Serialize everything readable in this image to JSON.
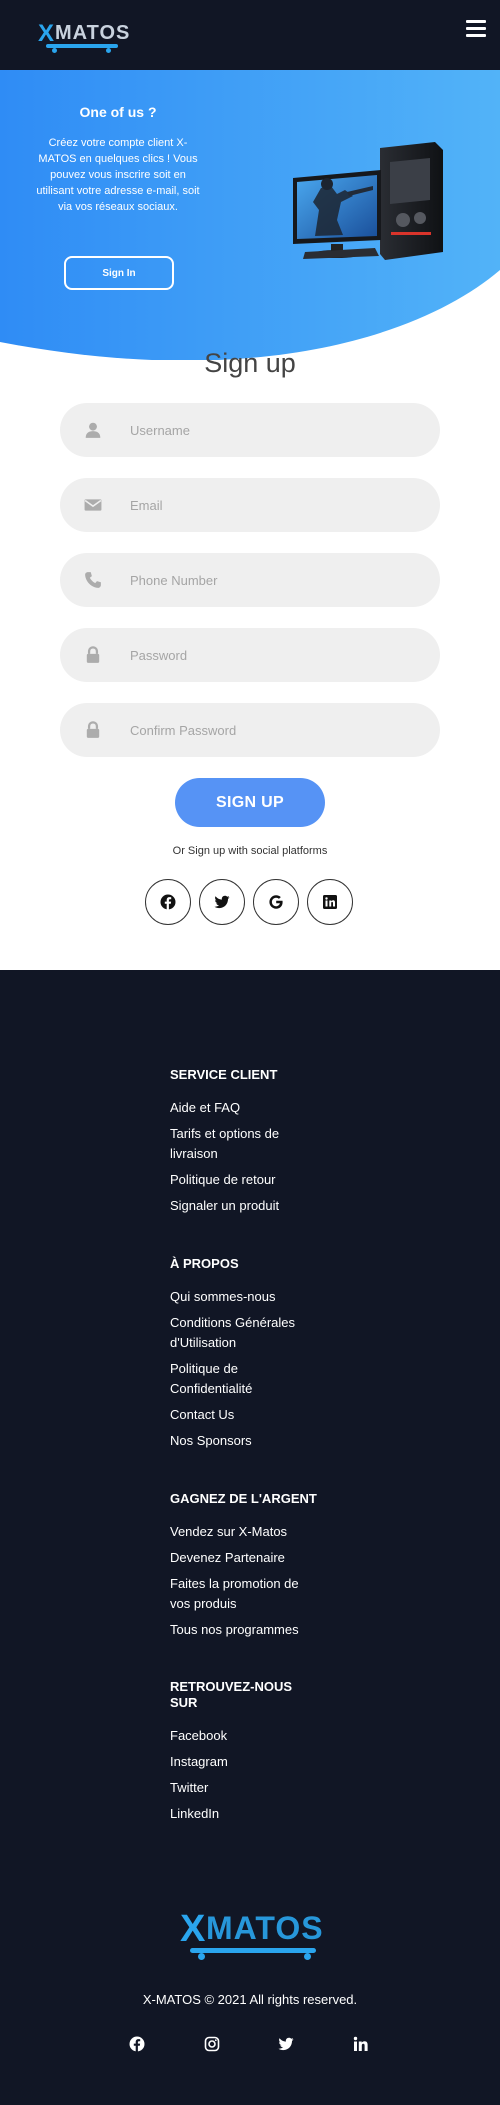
{
  "navbar": {
    "logo_text": "XMATOS",
    "menu_icon": "hamburger-menu-icon"
  },
  "hero": {
    "title": "One of us ?",
    "description": "Créez votre compte client X-MATOS en quelques clics ! Vous pouvez vous inscrire soit en utilisant votre adresse e-mail, soit via vos réseaux sociaux.",
    "signin_label": "Sign In",
    "gradient_start": "#2f8cf5",
    "gradient_end": "#52b3f8"
  },
  "form": {
    "title": "Sign up",
    "fields": [
      {
        "placeholder": "Username",
        "icon": "user-icon",
        "value": ""
      },
      {
        "placeholder": "Email",
        "icon": "envelope-icon",
        "value": ""
      },
      {
        "placeholder": "Phone Number",
        "icon": "phone-icon",
        "value": ""
      },
      {
        "placeholder": "Password",
        "icon": "lock-icon",
        "value": ""
      },
      {
        "placeholder": "Confirm Password",
        "icon": "lock-icon",
        "value": ""
      }
    ],
    "submit_label": "SIGN UP",
    "submit_color": "#5693f5",
    "social_text": "Or Sign up with social platforms",
    "social_icons": [
      "facebook-icon",
      "twitter-icon",
      "google-icon",
      "linkedin-icon"
    ]
  },
  "footer": {
    "background": "#111625",
    "sections": [
      {
        "title": "SERVICE CLIENT",
        "links": [
          "Aide et FAQ",
          "Tarifs et options de livraison",
          "Politique de retour",
          "Signaler un produit"
        ]
      },
      {
        "title": "À PROPOS",
        "links": [
          "Qui sommes-nous",
          "Conditions Générales d'Utilisation",
          "Politique de Confidentialité",
          "Contact Us",
          "Nos Sponsors"
        ]
      },
      {
        "title": "GAGNEZ DE L'ARGENT",
        "links": [
          "Vendez sur X-Matos",
          "Devenez Partenaire",
          "Faites la promotion de vos produis",
          "Tous nos programmes"
        ]
      },
      {
        "title": "RETROUVEZ-NOUS SUR",
        "links": [
          "Facebook",
          "Instagram",
          "Twitter",
          "LinkedIn"
        ]
      }
    ],
    "logo_text": "XMATOS",
    "copyright": "X-MATOS © 2021 All rights reserved.",
    "social_icons": [
      "facebook-icon",
      "instagram-icon",
      "twitter-icon",
      "linkedin-icon"
    ]
  }
}
